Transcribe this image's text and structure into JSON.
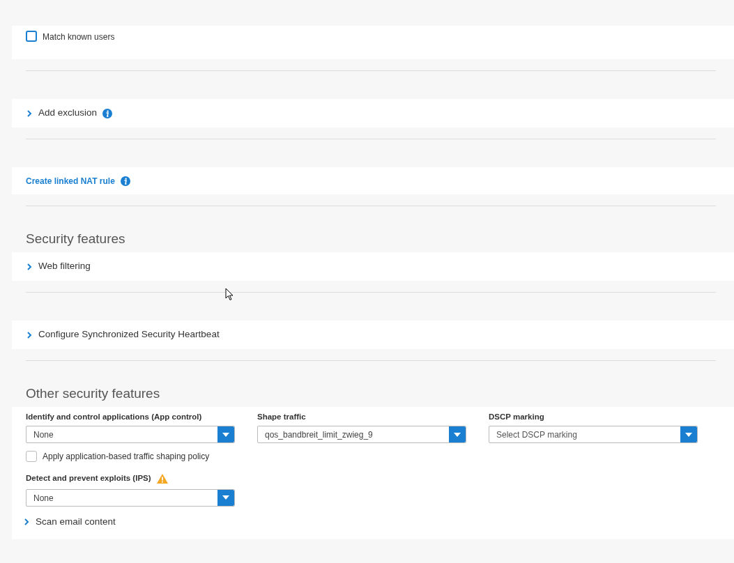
{
  "sections": [
    {
      "kind": "checkbox",
      "label": "Match known users",
      "checked": false
    },
    {
      "kind": "expander",
      "label": "Add exclusion",
      "info": true,
      "expanded": false
    },
    {
      "kind": "link",
      "label": "Create linked NAT rule",
      "info": true
    },
    {
      "kind": "heading",
      "label": "Security features"
    },
    {
      "kind": "expander",
      "label": "Web filtering",
      "expanded": false
    },
    {
      "kind": "expander",
      "label": "Configure Synchronized Security Heartbeat",
      "expanded": false
    },
    {
      "kind": "heading",
      "label": "Other security features"
    },
    {
      "kind": "form",
      "selects": [
        {
          "label": "Identify and control applications (App control)",
          "value": "None"
        },
        {
          "label": "Shape traffic",
          "value": "qos_bandbreit_limit_zwieg_9"
        },
        {
          "label": "DSCP marking",
          "placeholder": "Select DSCP marking"
        }
      ],
      "checkbox": {
        "label": "Apply application-based traffic shaping policy",
        "checked": false
      },
      "ips": {
        "label": "Detect and prevent exploits (IPS)",
        "warning": true,
        "value": "None"
      },
      "expander": {
        "label": "Scan email content",
        "expanded": false
      }
    }
  ]
}
